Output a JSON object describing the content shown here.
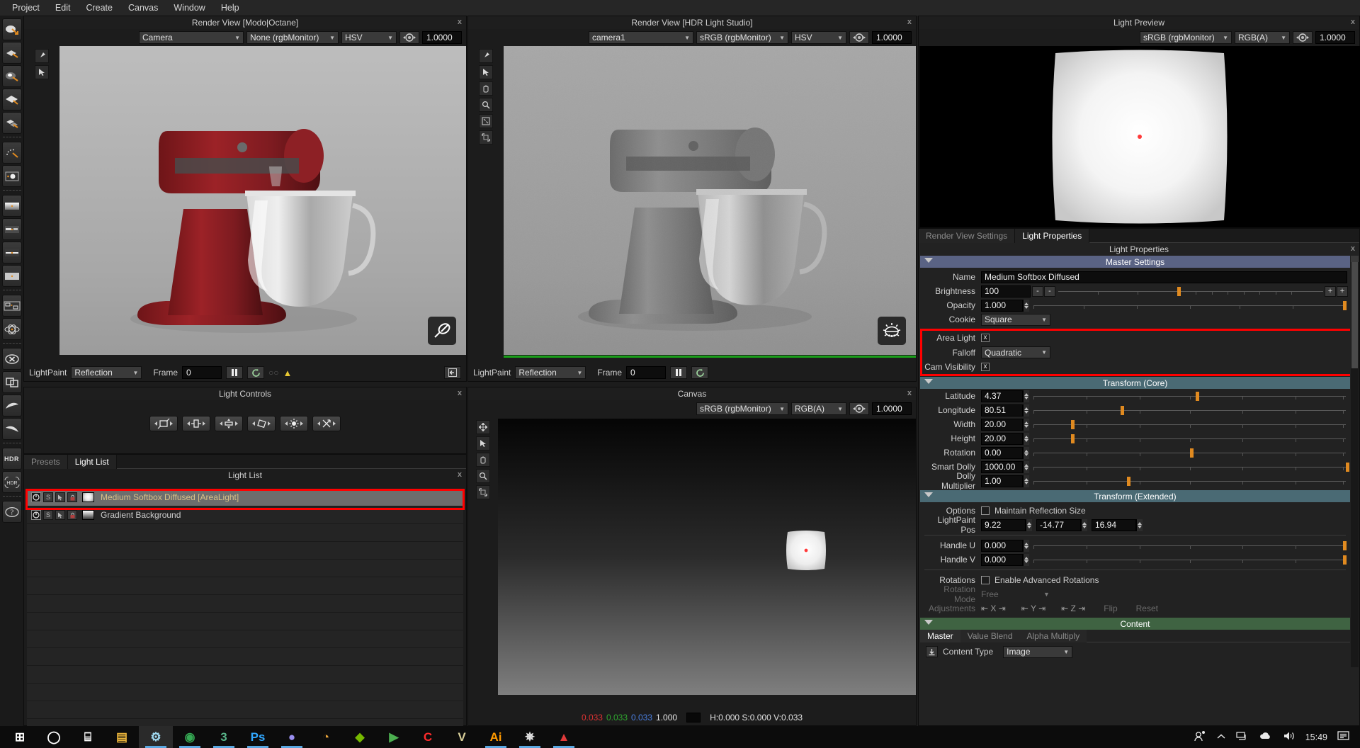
{
  "menubar": {
    "items": [
      "Project",
      "Edit",
      "Create",
      "Canvas",
      "Window",
      "Help"
    ]
  },
  "left_rail": {
    "icons": [
      "lightpaint-reflection-icon",
      "lightpaint-surface-icon",
      "lightpaint-highlight-icon",
      "lightpaint-plane-icon",
      "lightpaint-multi-icon",
      "lightpaint-arc-icon",
      "light-sun-icon",
      "area-light-icon",
      "strip-light-icon",
      "line-light-icon",
      "rect-light-icon",
      "node-layout-icon",
      "atom-icon",
      "delete-icon",
      "duplicate-icon",
      "curve-left-icon",
      "curve-right-icon",
      "hdr-icon",
      "hdr-rotate-icon",
      "help-icon"
    ]
  },
  "render_view_1": {
    "title": "Render View [Modo|Octane]",
    "close": "x",
    "camera": "Camera",
    "colorspace": "None (rgbMonitor)",
    "channel": "HSV",
    "exposure": "1.0000",
    "aperture_icon": "aperture-icon",
    "footer": {
      "lightpaint_label": "LightPaint",
      "lightpaint_mode": "Reflection",
      "frame_label": "Frame",
      "frame_value": "0",
      "pause_icon": "pause-icon",
      "refresh_icon": "refresh-icon",
      "warning_icon": "warning-icon",
      "collapse_icon": "collapse-icon"
    },
    "viewport_tools": [
      "pointer-icon",
      "hand-icon",
      "zoom-icon",
      "fit-icon",
      "expand-icon"
    ]
  },
  "render_view_2": {
    "title": "Render View [HDR Light Studio]",
    "close": "x",
    "camera": "camera1",
    "colorspace": "sRGB (rgbMonitor)",
    "channel": "HSV",
    "exposure": "1.0000",
    "footer": {
      "lightpaint_label": "LightPaint",
      "lightpaint_mode": "Reflection",
      "frame_label": "Frame",
      "frame_value": "0",
      "pause_icon": "pause-icon",
      "refresh_icon": "refresh-icon"
    }
  },
  "light_preview": {
    "title": "Light Preview",
    "close": "x",
    "colorspace": "sRGB (rgbMonitor)",
    "channel": "RGB(A)",
    "exposure": "1.0000"
  },
  "light_properties": {
    "tabs": [
      {
        "label": "Render View Settings",
        "active": false
      },
      {
        "label": "Light Properties",
        "active": true
      }
    ],
    "panel_title": "Light Properties",
    "close": "x",
    "sections": {
      "master": {
        "header": "Master Settings",
        "name_label": "Name",
        "name_value": "Medium Softbox Diffused",
        "brightness_label": "Brightness",
        "brightness_value": "100",
        "brightness_minus": "-",
        "brightness_minus2": "-",
        "brightness_plus": "+",
        "brightness_plus2": "+",
        "opacity_label": "Opacity",
        "opacity_value": "1.000",
        "cookie_label": "Cookie",
        "cookie_value": "Square",
        "area_light_label": "Area Light",
        "area_light_checked": "x",
        "falloff_label": "Falloff",
        "falloff_value": "Quadratic",
        "cam_visibility_label": "Cam Visibility",
        "cam_visibility_checked": "x"
      },
      "transform_core": {
        "header": "Transform (Core)",
        "rows": [
          {
            "label": "Latitude",
            "value": "4.37",
            "knob_pct": 52
          },
          {
            "label": "Longitude",
            "value": "80.51",
            "knob_pct": 28
          },
          {
            "label": "Width",
            "value": "20.00",
            "knob_pct": 12
          },
          {
            "label": "Height",
            "value": "20.00",
            "knob_pct": 12
          },
          {
            "label": "Rotation",
            "value": "0.00",
            "knob_pct": 50
          },
          {
            "label": "Smart Dolly",
            "value": "1000.00",
            "knob_pct": 100
          },
          {
            "label": "Dolly Multiplier",
            "value": "1.00",
            "knob_pct": 30
          }
        ]
      },
      "transform_extended": {
        "header": "Transform (Extended)",
        "options_label": "Options",
        "maintain_label": "Maintain Reflection Size",
        "maintain_checked": false,
        "lightpaint_pos_label": "LightPaint Pos",
        "lightpaint_pos": [
          "9.22",
          "-14.77",
          "16.94"
        ],
        "handle_rows": [
          {
            "label": "Handle U",
            "value": "0.000",
            "knob_pct": 99
          },
          {
            "label": "Handle V",
            "value": "0.000",
            "knob_pct": 99
          }
        ],
        "rotations_label": "Rotations",
        "advanced_rotations_label": "Enable Advanced Rotations",
        "advanced_rotations_checked": false,
        "rotation_mode_label": "Rotation Mode",
        "rotation_mode_value": "Free",
        "adjustments_label": "Adjustments",
        "axis_x": "X",
        "axis_y": "Y",
        "axis_z": "Z",
        "flip_label": "Flip",
        "reset_label": "Reset"
      },
      "content": {
        "header": "Content",
        "tabs": [
          {
            "label": "Master",
            "active": true
          },
          {
            "label": "Value Blend",
            "active": false
          },
          {
            "label": "Alpha Multiply",
            "active": false
          }
        ],
        "content_type_label": "Content Type",
        "content_type_value": "Image",
        "import_icon": "import-icon"
      }
    }
  },
  "light_controls": {
    "title": "Light Controls",
    "close": "x",
    "buttons": [
      "scale-both-icon",
      "width-icon",
      "height-icon",
      "rotate-icon",
      "brightness-icon",
      "move-diagonal-icon"
    ]
  },
  "light_list": {
    "tabs": [
      {
        "label": "Presets",
        "active": false
      },
      {
        "label": "Light List",
        "active": true
      }
    ],
    "panel_title": "Light List",
    "close": "x",
    "rows": [
      {
        "name": "Medium Softbox Diffused [AreaLight]",
        "selected": true,
        "swatch": "softbox",
        "buttons": [
          "power-icon",
          "solo-icon",
          "select-icon",
          "lock-icon"
        ]
      },
      {
        "name": "Gradient Background",
        "selected": false,
        "swatch": "gradient",
        "buttons": [
          "power-icon",
          "solo-icon",
          "select-icon",
          "lock-icon"
        ]
      }
    ],
    "blank_row_count": 12
  },
  "canvas": {
    "title": "Canvas",
    "close": "x",
    "colorspace": "sRGB (rgbMonitor)",
    "channel": "RGB(A)",
    "exposure": "1.0000",
    "tools": [
      "move-icon",
      "pointer-icon",
      "hand-icon",
      "zoom-icon",
      "fit-icon"
    ],
    "status": {
      "r": "0.033",
      "g": "0.033",
      "b": "0.033",
      "a": "1.000",
      "hsv": "H:0.000 S:0.000 V:0.033",
      "swatch_color": "#080808"
    }
  },
  "taskbar": {
    "items": [
      {
        "name": "start-button",
        "glyph": "⊞",
        "color": "#ffffff",
        "active": false,
        "underline": false
      },
      {
        "name": "cortana-search-button",
        "glyph": "◯",
        "color": "#ffffff",
        "active": false,
        "underline": false
      },
      {
        "name": "task-view-button",
        "glyph": "⌸",
        "color": "#ffffff",
        "active": false,
        "underline": false
      },
      {
        "name": "file-explorer-button",
        "glyph": "▤",
        "color": "#e8b33a",
        "active": false,
        "underline": false
      },
      {
        "name": "hdr-light-studio-button",
        "glyph": "⚙",
        "color": "#9fd8f0",
        "active": true,
        "underline": true
      },
      {
        "name": "chrome-button",
        "glyph": "◉",
        "color": "#35a853",
        "active": false,
        "underline": true
      },
      {
        "name": "modo-button",
        "glyph": "3",
        "color": "#58b58a",
        "active": false,
        "underline": true
      },
      {
        "name": "photoshop-button",
        "glyph": "Ps",
        "color": "#31a8ff",
        "active": false,
        "underline": true
      },
      {
        "name": "substance-button",
        "glyph": "●",
        "color": "#9a8ff0",
        "active": false,
        "underline": true
      },
      {
        "name": "houdini-button",
        "glyph": "◔",
        "color": "#e8a33a",
        "active": false,
        "underline": false
      },
      {
        "name": "nvidia-button",
        "glyph": "◆",
        "color": "#76b900",
        "active": false,
        "underline": false
      },
      {
        "name": "media-player-button",
        "glyph": "▶",
        "color": "#4caf50",
        "active": false,
        "underline": false
      },
      {
        "name": "cinema4d-button",
        "glyph": "C",
        "color": "#ff2b2b",
        "active": false,
        "underline": false
      },
      {
        "name": "vray-button",
        "glyph": "V",
        "color": "#d9cf9a",
        "active": false,
        "underline": false
      },
      {
        "name": "illustrator-button",
        "glyph": "Ai",
        "color": "#ff9a00",
        "active": false,
        "underline": true
      },
      {
        "name": "slack-button",
        "glyph": "✵",
        "color": "#e0e0e0",
        "active": false,
        "underline": true
      },
      {
        "name": "keyshot-button",
        "glyph": "▲",
        "color": "#e03a3a",
        "active": false,
        "underline": true
      }
    ],
    "tray": {
      "people_icon": "people-icon",
      "chevron_icon": "chevron-up-icon",
      "network_icon": "network-icon",
      "onedrive_icon": "onedrive-icon",
      "volume_icon": "volume-icon",
      "clock": "15:49",
      "notifications_icon": "notifications-icon"
    }
  }
}
